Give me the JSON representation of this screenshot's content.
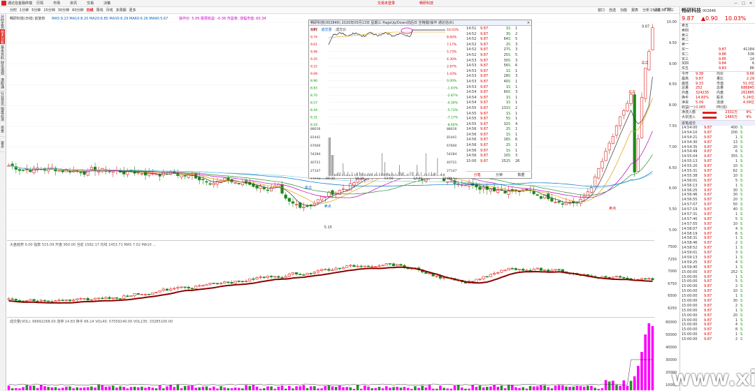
{
  "titlebar": {
    "app": "通达信金融终端",
    "menus": [
      "行情",
      "市场",
      "资讯",
      "交易",
      "决策"
    ],
    "ad1": "交易未登录",
    "ad2": "畅研科技",
    "win": [
      "—",
      "□",
      "✕"
    ]
  },
  "toolbar": {
    "periods": [
      "分时",
      "1分钟",
      "5分钟",
      "15分钟",
      "30分钟",
      "60分钟",
      "日线",
      "周线",
      "月线",
      "多周期",
      "更多"
    ],
    "active": 6,
    "right": [
      "窗口",
      "自选",
      "功能",
      "报表",
      "分析",
      "设置",
      "F10"
    ],
    "time": "15:55:36 周三"
  },
  "leftnav": [
    "分时走势",
    "技术分析",
    "基本资料",
    "财务透视",
    "港股通",
    "行业资讯",
    "操盘必读",
    "资金",
    "更多"
  ],
  "leftnav_active": 1,
  "main": {
    "title": "畅研科技(日线) 前复权",
    "ma": "MA5:9.23 MA10:8.20 MA20:6.85 MA30:6.29 MA60:6.26 MA90:5.67",
    "extra": "操作价: 5.09 极限收益: -0.36 市盈率: 涨幅市值: 60.34",
    "high": "9.87",
    "low": "5.15",
    "labels": [
      "卖点",
      "卖点",
      "卖点",
      "买点",
      "买点"
    ]
  },
  "main_axis": [
    "10.00",
    "9.50",
    "9.00",
    "8.50",
    "8.00",
    "7.50",
    "7.00",
    "6.50",
    "6.00",
    "5.50",
    "5.00"
  ],
  "index_pane": {
    "legend": "大盘趋势 0.00 指数 515.09 开盘 950.00 当前 1582.17 均线 1453.71 MA5 7.02 MA10 ...",
    "axis": [
      "7500",
      "7250",
      "7000",
      "6750",
      "6500",
      "6250"
    ]
  },
  "vol_pane": {
    "legend": "成交量(VOL): 66692268.00 涨停 14.83 换手 66.14 VOL40: 57059140.00 VOL135: 33285100.00",
    "axis": [
      "60000",
      "50000",
      "40000",
      "30000",
      "20000",
      "10000"
    ]
  },
  "popup": {
    "title": "畅研科技(002846) 2020年05月13日 星期三 PageUp/Down前后日 空格键/操作 通达信(K)",
    "tabs": [
      "分时",
      "成交量",
      "成交价"
    ],
    "price_labels": [
      "9.87",
      "9.74",
      "9.61",
      "9.48",
      "9.35",
      "9.22",
      "9.09",
      "8.96",
      "8.83",
      "8.70",
      "8.57",
      "8.44",
      "8.31",
      "8.18"
    ],
    "pct_labels": [
      "10.03%",
      "8.60%",
      "7.17%",
      "5.73%",
      "4.30%",
      "2.87%",
      "1.43%",
      "0.00%",
      "-1.43%",
      "-2.87%",
      "-4.30%",
      "-5.73%",
      "-7.17%",
      "-8.60%"
    ],
    "vol_labels": [
      "88016",
      "81441",
      "67600",
      "54284",
      "40721",
      "27147",
      "13574"
    ],
    "time_labels": [
      "09:30",
      "10:30",
      "13:00",
      "14:00",
      "15:00"
    ],
    "bottom_tabs": [
      "分笔",
      "分钟",
      "数据"
    ]
  },
  "ticks": [
    [
      "14:51",
      "9.87",
      "1",
      "S",
      "1"
    ],
    [
      "14:52",
      "9.87",
      "3",
      "S",
      "2"
    ],
    [
      "14:52",
      "9.87",
      "64",
      "S",
      "5"
    ],
    [
      "14:52",
      "9.87",
      "2",
      "S",
      "3"
    ],
    [
      "14:52",
      "9.87",
      "27",
      "S",
      "3"
    ],
    [
      "14:52",
      "9.87",
      "25",
      "S",
      "5"
    ],
    [
      "14:53",
      "9.87",
      "30",
      "S",
      "3"
    ],
    [
      "14:53",
      "9.87",
      "56",
      "S",
      "6"
    ],
    [
      "14:53",
      "9.87",
      "1",
      "S",
      "1"
    ],
    [
      "14:53",
      "9.87",
      "28",
      "S",
      "3"
    ],
    [
      "14:53",
      "9.87",
      "40",
      "S",
      "1"
    ],
    [
      "14:53",
      "9.87",
      "1",
      "S",
      "1"
    ],
    [
      "14:54",
      "9.87",
      "60",
      "S",
      "3"
    ],
    [
      "14:54",
      "9.87",
      "1",
      "S",
      "1"
    ],
    [
      "14:54",
      "9.87",
      "1",
      "S",
      "1"
    ],
    [
      "14:55",
      "9.87",
      "131",
      "S",
      "2"
    ],
    [
      "14:55",
      "9.87",
      "1",
      "S",
      "1"
    ],
    [
      "14:55",
      "9.87",
      "5",
      "S",
      "1"
    ],
    [
      "14:55",
      "9.87",
      "32",
      "S",
      "4"
    ],
    [
      "14:56",
      "9.87",
      "2",
      "S",
      "1"
    ],
    [
      "14:56",
      "9.87",
      "1",
      "S",
      "1"
    ],
    [
      "14:56",
      "9.87",
      "16",
      "S",
      "6"
    ],
    [
      "14:56",
      "9.87",
      "2",
      "S",
      "1"
    ],
    [
      "14:56",
      "9.87",
      "1",
      "S",
      "1"
    ],
    [
      "14:56",
      "9.87",
      "10",
      "S",
      "3"
    ],
    [
      "15:00",
      "9.87",
      "252",
      "S",
      "26"
    ]
  ],
  "quote": {
    "name": "畅研科技",
    "code": "002846",
    "price": "9.87",
    "change": "▲0.90",
    "pct": "10.03%",
    "sells": [
      [
        "卖五",
        "",
        ""
      ],
      [
        "卖四",
        "",
        ""
      ],
      [
        "卖三",
        "",
        ""
      ],
      [
        "卖二",
        "",
        ""
      ],
      [
        "卖一",
        "",
        ""
      ]
    ],
    "buys": [
      [
        "买一",
        "9.87",
        "41184"
      ],
      [
        "买二",
        "9.86",
        "536"
      ],
      [
        "买三",
        "9.85",
        "14"
      ],
      [
        "买四",
        "9.84",
        "6"
      ],
      [
        "买五",
        "9.83",
        "86"
      ]
    ],
    "stats": [
      [
        "今开",
        "9.38",
        "均价",
        "9.66"
      ],
      [
        "最高",
        "9.87",
        "量比",
        "2.29"
      ],
      [
        "最低",
        "9.33",
        "市值",
        "51.0亿"
      ],
      [
        "总量",
        "252",
        "总量",
        "686845"
      ],
      [
        "外盘",
        "324235",
        "内盘",
        "261885"
      ],
      [
        "换手",
        "14.83%",
        "股本",
        "5.24亿"
      ],
      [
        "净资",
        "5.09",
        "流通",
        "4.09亿"
      ],
      [
        "收益(一)",
        "0.065",
        "PE(动)",
        ""
      ]
    ],
    "flows": [
      [
        "净流入额",
        "2331万",
        "4%"
      ],
      [
        "大宗流入",
        "2465万",
        "4%"
      ]
    ],
    "deal_header": "逐笔成交",
    "deals": [
      [
        "14:54:00",
        "9.87",
        "400"
      ],
      [
        "14:54:10",
        "9.87",
        "200"
      ],
      [
        "14:54:21",
        "9.87",
        "1"
      ],
      [
        "14:54:30",
        "9.87",
        "13"
      ],
      [
        "14:54:35",
        "9.87",
        "20"
      ],
      [
        "14:54:49",
        "9.87",
        "6"
      ],
      [
        "14:55:04",
        "9.87",
        "355"
      ],
      [
        "14:55:13",
        "9.87",
        "1"
      ],
      [
        "14:55:20",
        "9.87",
        "10"
      ],
      [
        "14:55:31",
        "9.87",
        "62"
      ],
      [
        "14:55:38",
        "9.87",
        "10"
      ],
      [
        "14:56:01",
        "9.87",
        "5"
      ],
      [
        "14:56:13",
        "9.87",
        "1"
      ],
      [
        "14:56:25",
        "9.87",
        "30"
      ],
      [
        "14:56:46",
        "9.87",
        "30"
      ],
      [
        "14:56:55",
        "9.87",
        "20"
      ],
      [
        "14:57:07",
        "9.87",
        "50"
      ],
      [
        "14:57:19",
        "9.87",
        "40"
      ],
      [
        "14:57:31",
        "9.87",
        "1"
      ],
      [
        "14:57:40",
        "9.87",
        "5"
      ],
      [
        "14:57:55",
        "9.87",
        "10"
      ],
      [
        "14:58:07",
        "9.87",
        "4"
      ],
      [
        "14:58:19",
        "9.87",
        "6"
      ],
      [
        "14:58:31",
        "9.87",
        "1"
      ],
      [
        "14:58:46",
        "9.87",
        "2"
      ],
      [
        "14:58:52",
        "9.87",
        "1"
      ],
      [
        "14:59:01",
        "9.87",
        "3"
      ],
      [
        "14:59:13",
        "9.87",
        "1"
      ],
      [
        "14:59:25",
        "9.87",
        "4"
      ],
      [
        "14:59:40",
        "9.87",
        "1"
      ],
      [
        "15:00:00",
        "9.87",
        "252"
      ],
      [
        "15:00:00",
        "9.87",
        "1"
      ],
      [
        "15:00:00",
        "9.87",
        "5"
      ],
      [
        "15:00:00",
        "9.87",
        "2"
      ],
      [
        "15:00:00",
        "9.87",
        "10"
      ],
      [
        "15:00:00",
        "9.87",
        "1"
      ],
      [
        "15:00:00",
        "9.87",
        "30"
      ],
      [
        "15:00:00",
        "9.87",
        "2"
      ],
      [
        "15:00:00",
        "9.87",
        "1"
      ],
      [
        "15:00:00",
        "9.87",
        "20"
      ],
      [
        "15:00:00",
        "9.87",
        "1"
      ],
      [
        "15:00:00",
        "9.87",
        "4"
      ],
      [
        "15:00:00",
        "9.87",
        "8"
      ],
      [
        "15:00:00",
        "9.87",
        "1"
      ],
      [
        "15:00:00",
        "9.87",
        "2"
      ]
    ]
  },
  "watermark": "www.xiarj.com",
  "colors": {
    "up": "#e02020",
    "down": "#1a8a1a",
    "accent": "#d9322c"
  }
}
